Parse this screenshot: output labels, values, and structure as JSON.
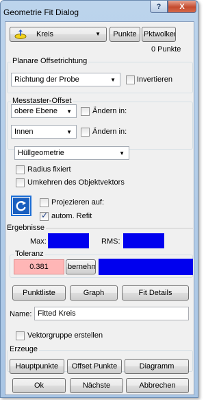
{
  "window": {
    "title": "Geometrie Fit Dialog",
    "help_glyph": "?",
    "close_glyph": "X"
  },
  "top": {
    "feature_combo": "Kreis",
    "punkte_button": "Punkte",
    "pktwolke_button": "Pktwolker",
    "punkte_count": "0 Punkte"
  },
  "offset_dir": {
    "group_label": "Planare Offsetrichtung",
    "combo": "Richtung der Probe",
    "invert_label": "Invertieren"
  },
  "probe_offset": {
    "group_label": "Messtaster-Offset",
    "combo1": "obere Ebene",
    "change1_label": "Ändern in:",
    "combo2": "Innen",
    "change2_label": "Ändern in:"
  },
  "options": {
    "hull_combo": "Hüllgeometrie",
    "radius_fixed_label": "Radius fixiert",
    "reverse_vector_label": "Umkehren des Objektvektors",
    "project_label": "Projezieren auf:",
    "auto_refit_label": "autom. Refit",
    "auto_refit_checked": true
  },
  "results": {
    "group_label": "Ergebnisse",
    "max_label": "Max:",
    "rms_label": "RMS:",
    "tolerance_label": "Toleranz",
    "tolerance_value": "0.381",
    "apply_button": "bernehmı",
    "value_fill_color": "#0000ee",
    "tolerance_fill_color": "#ffb6b6"
  },
  "actions": {
    "point_list_button": "Punktliste",
    "graph_button": "Graph",
    "fit_details_button": "Fit Details",
    "name_label": "Name:",
    "name_value": "Fitted Kreis",
    "vector_group_label": "Vektorgruppe erstellen"
  },
  "create": {
    "group_label": "Erzeuge",
    "main_points_button": "Hauptpunkte",
    "offset_points_button": "Offset Punkte",
    "diagram_button": "Diagramm"
  },
  "footer": {
    "ok_button": "Ok",
    "next_button": "Nächste",
    "cancel_button": "Abbrechen"
  }
}
